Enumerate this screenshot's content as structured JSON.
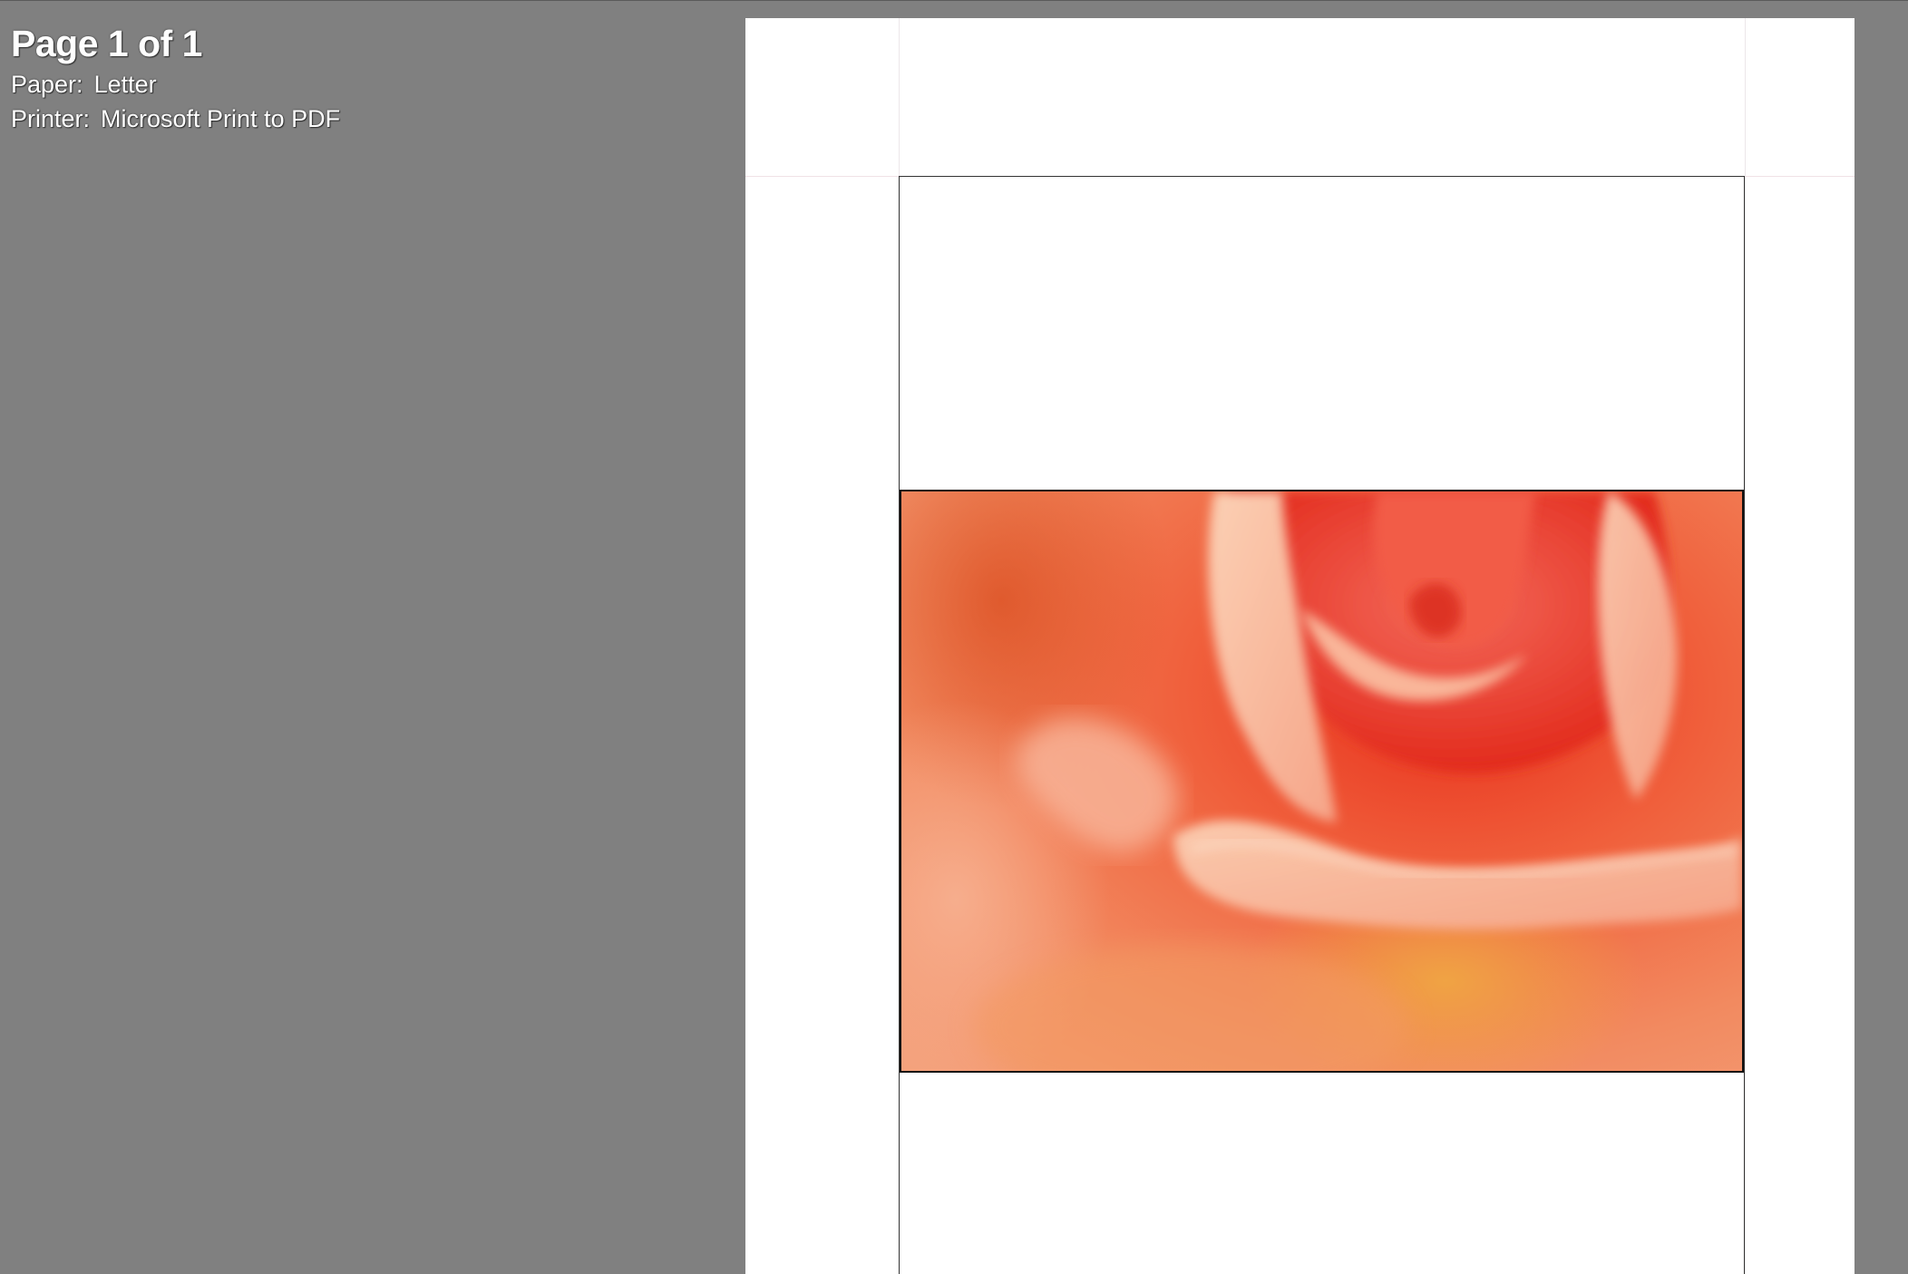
{
  "print_info": {
    "page_count": "Page 1 of 1",
    "paper_label": "Paper:",
    "paper_value": "Letter",
    "printer_label": "Printer:",
    "printer_value": "Microsoft Print to PDF"
  },
  "preview": {
    "background_color": "#808080",
    "paper_color": "#ffffff",
    "photo_subject": "rose-photo"
  }
}
